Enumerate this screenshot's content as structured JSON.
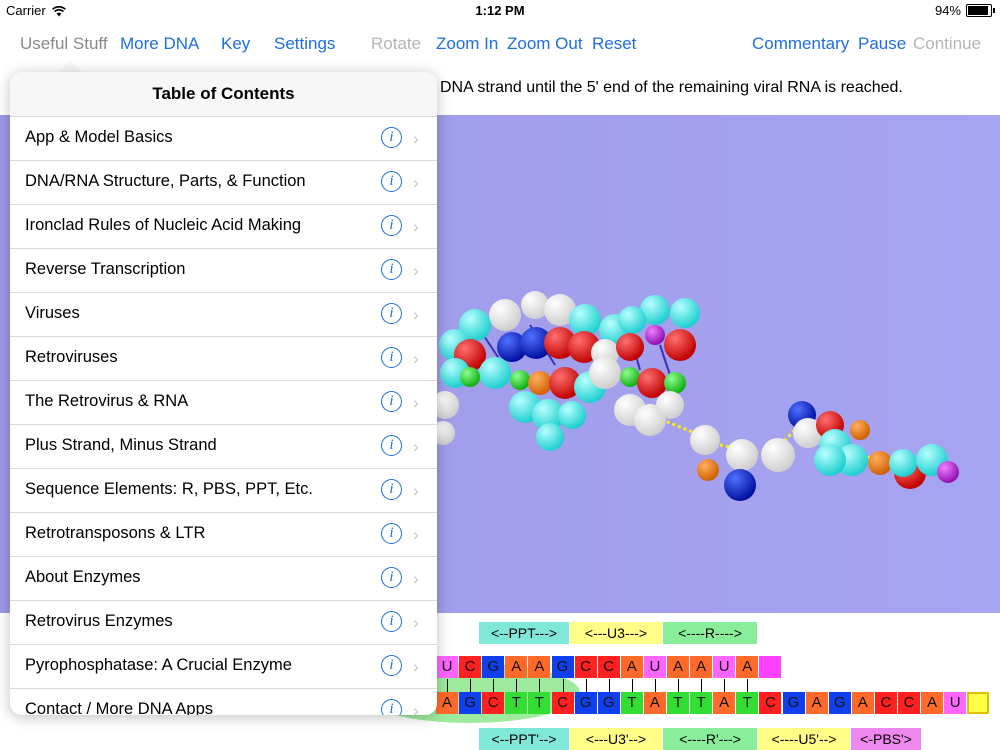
{
  "status": {
    "carrier": "Carrier",
    "time": "1:12 PM",
    "battery": "94%"
  },
  "toolbar": {
    "useful_stuff": "Useful Stuff",
    "more_dna": "More DNA",
    "key": "Key",
    "settings": "Settings",
    "rotate": "Rotate",
    "zoom_in": "Zoom In",
    "zoom_out": "Zoom Out",
    "reset": "Reset",
    "commentary": "Commentary",
    "pause": "Pause",
    "continue": "Continue"
  },
  "caption": "DNA strand until the 5' end of the remaining viral RNA is reached.",
  "toc": {
    "title": "Table of Contents",
    "items": [
      "App & Model Basics",
      "DNA/RNA Structure, Parts, & Function",
      "Ironclad Rules of Nucleic Acid Making",
      "Reverse Transcription",
      "Viruses",
      "Retroviruses",
      "The Retrovirus & RNA",
      "Plus Strand, Minus Strand",
      "Sequence Elements: R, PBS, PPT, Etc.",
      "Retrotransposons & LTR",
      "About Enzymes",
      "Retrovirus Enzymes",
      "Pyrophosphatase: A Crucial Enzyme",
      "Contact / More DNA Apps"
    ],
    "info_glyph": "i",
    "chevron_glyph": "›"
  },
  "sequence": {
    "top_labels": [
      "<--PPT--->",
      "<---U3--->",
      "<----R---->"
    ],
    "rna": [
      "U",
      "C",
      "G",
      "A",
      "A",
      "G",
      "C",
      "C",
      "A",
      "U",
      "A",
      "A",
      "U",
      "A",
      ""
    ],
    "dna": [
      "A",
      "G",
      "C",
      "T",
      "T",
      "C",
      "G",
      "G",
      "T",
      "A",
      "T",
      "T",
      "A",
      "T",
      "C",
      "G",
      "A",
      "G",
      "A",
      "C",
      "C",
      "A",
      "U",
      ""
    ],
    "bottom_labels": [
      "<--PPT'-->",
      "<---U3'-->",
      "<----R'--->",
      "<----U5'-->",
      "<-PBS'>"
    ]
  },
  "colors": {
    "link_blue": "#1f6fe0",
    "viewer_bg": "#a3a0ee",
    "A": "#ff6a2a",
    "U": "#ff66ff",
    "T": "#33dd33",
    "G": "#1040ee",
    "C": "#ff2020"
  }
}
